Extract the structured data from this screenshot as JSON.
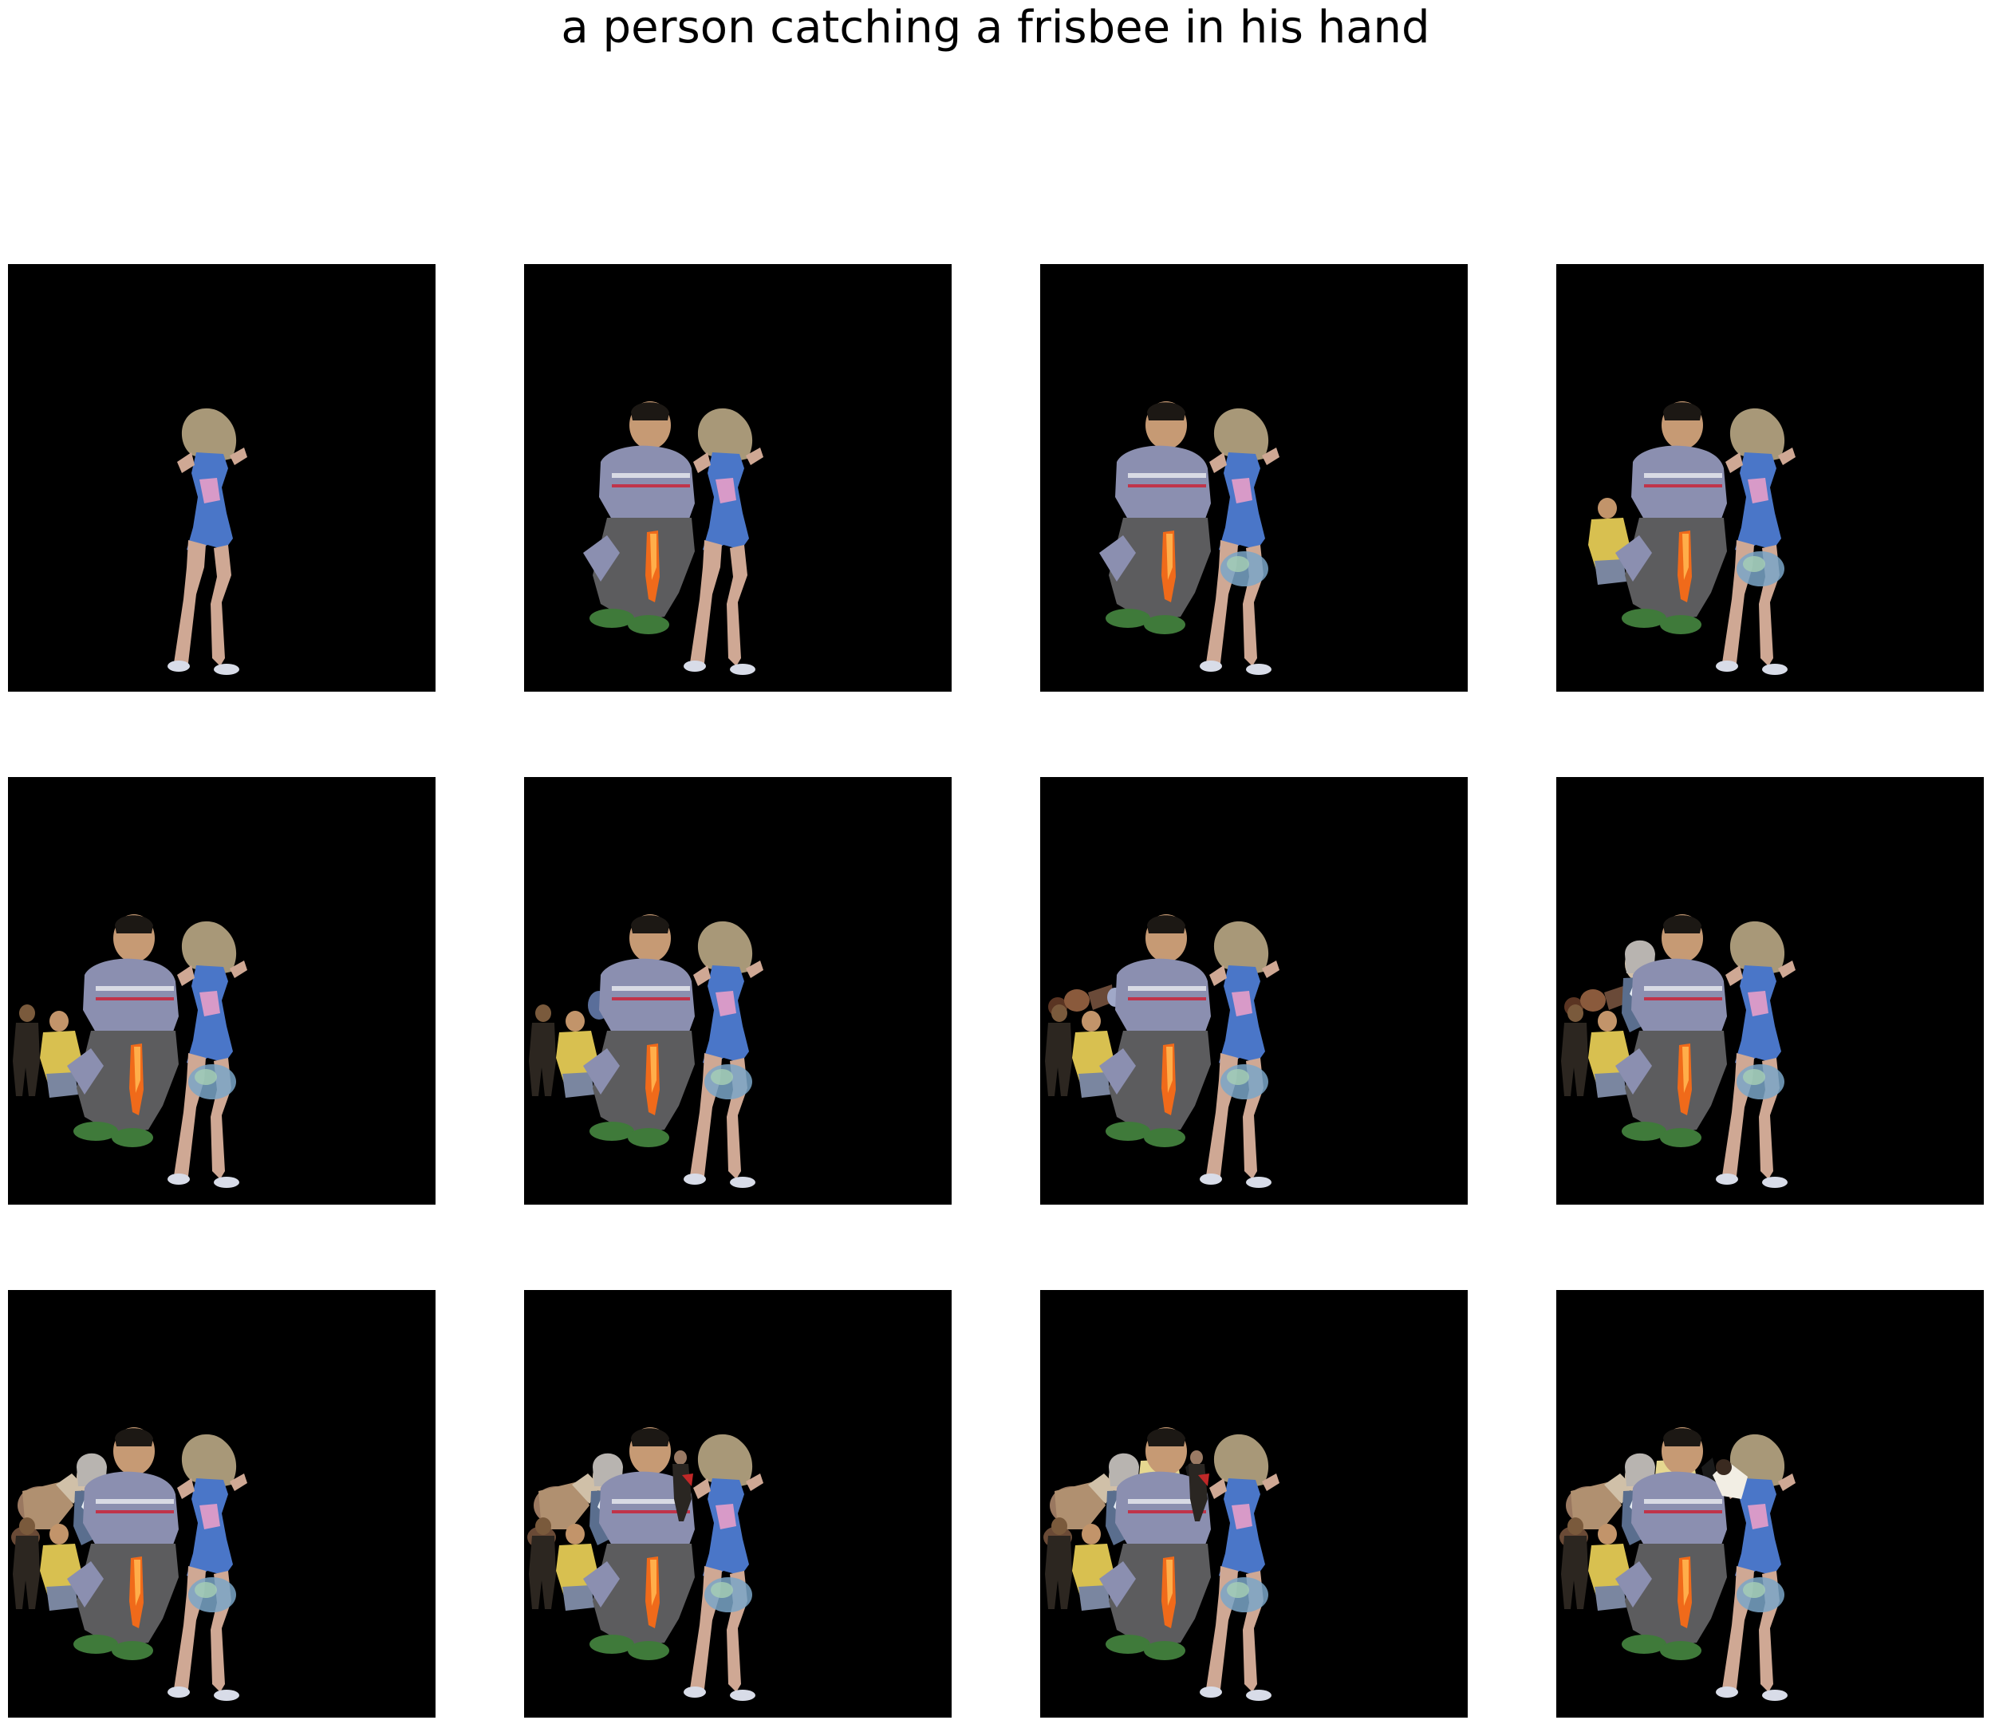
{
  "figure": {
    "title": "a person catching a frisbee in his hand",
    "colors": {
      "background": "#ffffff",
      "panel": "#000000"
    },
    "panels": [
      {
        "step": 1,
        "layers": [
          "girl"
        ]
      },
      {
        "step": 2,
        "layers": [
          "man",
          "frisbee",
          "girl"
        ]
      },
      {
        "step": 3,
        "layers": [
          "man",
          "frisbee",
          "girl",
          "ball"
        ]
      },
      {
        "step": 4,
        "layers": [
          "yellow-person",
          "man",
          "frisbee",
          "girl",
          "ball"
        ]
      },
      {
        "step": 5,
        "layers": [
          "dark-person",
          "yellow-person",
          "man",
          "frisbee",
          "girl",
          "ball"
        ]
      },
      {
        "step": 6,
        "layers": [
          "dark-person",
          "yellow-person",
          "blue-blob",
          "man",
          "frisbee",
          "girl",
          "ball"
        ]
      },
      {
        "step": 7,
        "layers": [
          "crowd-left",
          "dark-person",
          "yellow-person",
          "man",
          "frisbee",
          "girl",
          "ball"
        ]
      },
      {
        "step": 8,
        "layers": [
          "crowd-left",
          "dark-person",
          "yellow-person",
          "woman",
          "man",
          "frisbee",
          "girl",
          "ball"
        ]
      },
      {
        "step": 9,
        "layers": [
          "crowd-big",
          "dark-person",
          "yellow-person",
          "woman",
          "man",
          "frisbee",
          "girl",
          "ball"
        ]
      },
      {
        "step": 10,
        "layers": [
          "crowd-big",
          "dark-person",
          "yellow-person",
          "woman",
          "man",
          "frisbee",
          "girl",
          "ball",
          "small-standing"
        ]
      },
      {
        "step": 11,
        "layers": [
          "crowd-big",
          "dark-person",
          "yellow-person",
          "woman",
          "sitting-man",
          "man",
          "frisbee",
          "girl",
          "ball",
          "small-standing"
        ]
      },
      {
        "step": 12,
        "layers": [
          "crowd-big",
          "dark-person",
          "yellow-person",
          "woman",
          "sitting-man",
          "man",
          "frisbee",
          "girl",
          "ball",
          "white-shape"
        ]
      }
    ]
  }
}
